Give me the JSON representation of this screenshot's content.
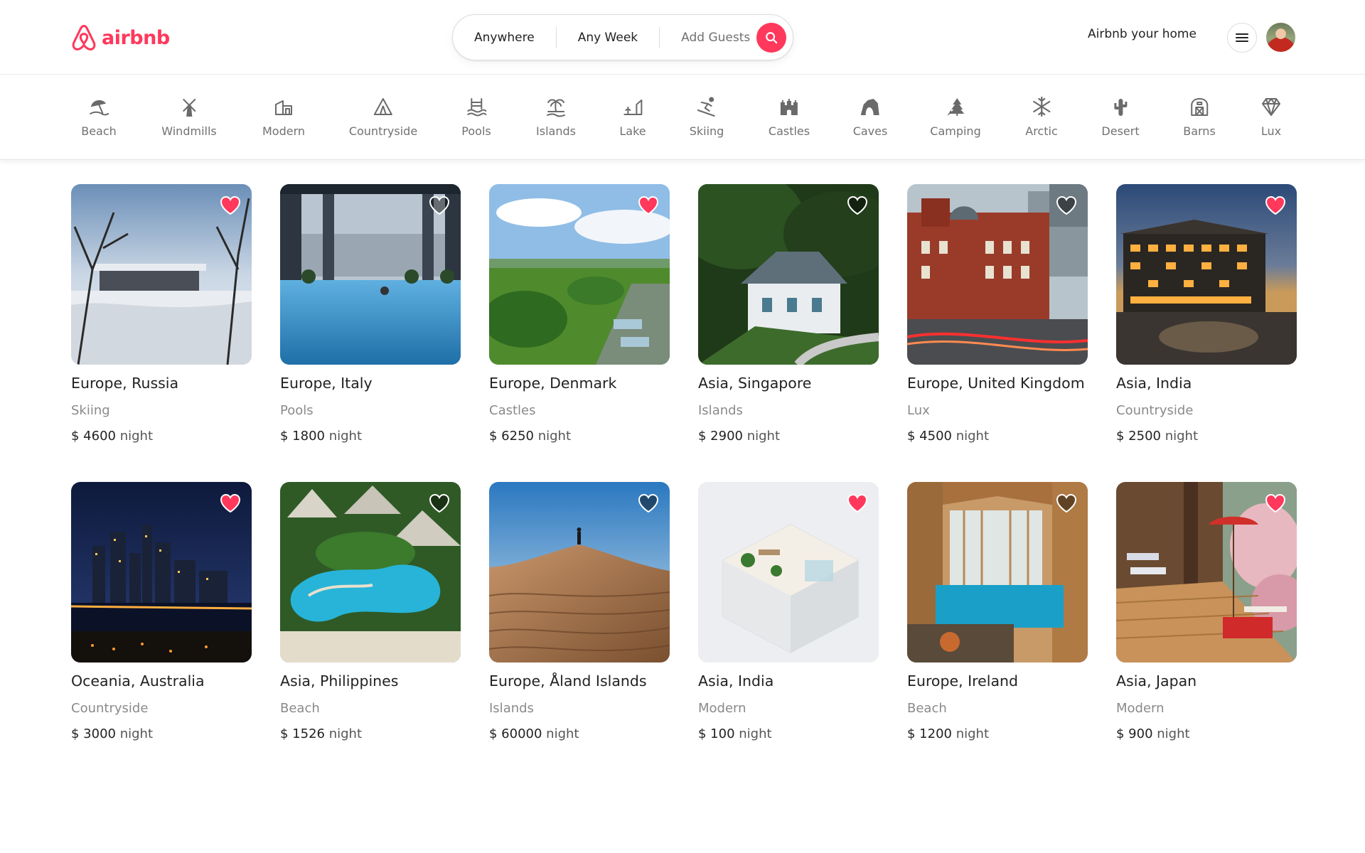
{
  "brand": {
    "name": "airbnb",
    "color": "#ff385c",
    "icon": "airbnb-logo-icon"
  },
  "search": {
    "where": "Anywhere",
    "when": "Any Week",
    "guests": "Add Guests",
    "button_icon": "search-icon"
  },
  "header": {
    "host_link": "Airbnb your home",
    "menu_icon": "hamburger-menu-icon",
    "avatar": "user-avatar"
  },
  "categories": [
    {
      "label": "Beach",
      "icon": "beach-umbrella-icon"
    },
    {
      "label": "Windmills",
      "icon": "windmill-icon"
    },
    {
      "label": "Modern",
      "icon": "modern-house-icon"
    },
    {
      "label": "Countryside",
      "icon": "tent-icon"
    },
    {
      "label": "Pools",
      "icon": "pool-icon"
    },
    {
      "label": "Islands",
      "icon": "palm-island-icon"
    },
    {
      "label": "Lake",
      "icon": "lake-icon"
    },
    {
      "label": "Skiing",
      "icon": "skier-icon"
    },
    {
      "label": "Castles",
      "icon": "castle-icon"
    },
    {
      "label": "Caves",
      "icon": "cave-icon"
    },
    {
      "label": "Camping",
      "icon": "pine-tree-icon"
    },
    {
      "label": "Arctic",
      "icon": "snowflake-icon"
    },
    {
      "label": "Desert",
      "icon": "cactus-icon"
    },
    {
      "label": "Barns",
      "icon": "barn-icon"
    },
    {
      "label": "Lux",
      "icon": "diamond-icon"
    }
  ],
  "listings": [
    {
      "location": "Europe, Russia",
      "category": "Skiing",
      "price": "$ 4600",
      "unit": "night",
      "favorited": true,
      "photo": "snowy winter estate"
    },
    {
      "location": "Europe, Italy",
      "category": "Pools",
      "price": "$ 1800",
      "unit": "night",
      "favorited": false,
      "photo": "infinity pool city view"
    },
    {
      "location": "Europe, Denmark",
      "category": "Castles",
      "price": "$ 6250",
      "unit": "night",
      "favorited": true,
      "photo": "green park with fountains"
    },
    {
      "location": "Asia, Singapore",
      "category": "Islands",
      "price": "$ 2900",
      "unit": "night",
      "favorited": false,
      "photo": "colonial house in forest"
    },
    {
      "location": "Europe, United Kingdom",
      "category": "Lux",
      "price": "$ 4500",
      "unit": "night",
      "favorited": false,
      "photo": "red brick hotel"
    },
    {
      "location": "Asia, India",
      "category": "Countryside",
      "price": "$ 2500",
      "unit": "night",
      "favorited": true,
      "photo": "lit hotel at dusk"
    },
    {
      "location": "Oceania, Australia",
      "category": "Countryside",
      "price": "$ 3000",
      "unit": "night",
      "favorited": true,
      "photo": "city skyline at night"
    },
    {
      "location": "Asia, Philippines",
      "category": "Beach",
      "price": "$ 1526",
      "unit": "night",
      "favorited": false,
      "photo": "tropical resort pool"
    },
    {
      "location": "Europe, Åland Islands",
      "category": "Islands",
      "price": "$ 60000",
      "unit": "night",
      "favorited": false,
      "photo": "sand dune with walker"
    },
    {
      "location": "Asia, India",
      "category": "Modern",
      "price": "$ 100",
      "unit": "night",
      "favorited": true,
      "photo": "isometric room model"
    },
    {
      "location": "Europe, Ireland",
      "category": "Beach",
      "price": "$ 1200",
      "unit": "night",
      "favorited": false,
      "photo": "indoor pool conservatory"
    },
    {
      "location": "Asia, Japan",
      "category": "Modern",
      "price": "$ 900",
      "unit": "night",
      "favorited": true,
      "photo": "japanese veranda"
    }
  ],
  "colors": {
    "accent": "#ff385c",
    "text": "#222222",
    "muted": "#717171",
    "heart_on": "#ff385c",
    "heart_off": "rgba(0,0,0,0.5)"
  }
}
